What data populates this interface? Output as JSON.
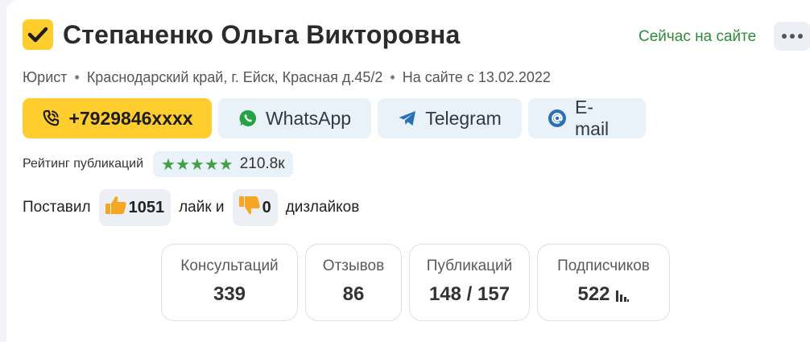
{
  "profile": {
    "name": "Степаненко Ольга Викторовна",
    "online_status": "Сейчас на сайте",
    "role": "Юрист",
    "location": "Краснодарский край, г. Ейск, Красная д.45/2",
    "member_since": "На сайте с 13.02.2022",
    "separator": "•"
  },
  "contacts": {
    "phone": "+7929846xxxx",
    "whatsapp": "WhatsApp",
    "telegram": "Telegram",
    "email": "E-mail"
  },
  "rating": {
    "label": "Рейтинг публикаций",
    "stars": "★★★★★",
    "value": "210.8к"
  },
  "reactions": {
    "prefix": "Поставил",
    "likes": "1051",
    "middle": "лайк и",
    "dislikes": "0",
    "suffix": "дизлайков"
  },
  "stats": [
    {
      "label": "Консультаций",
      "value": "339"
    },
    {
      "label": "Отзывов",
      "value": "86"
    },
    {
      "label": "Публикаций",
      "value": "148 / 157"
    },
    {
      "label": "Подписчиков",
      "value": "522"
    }
  ],
  "colors": {
    "accent_yellow": "#ffcd2e",
    "online_green": "#2e8b3a",
    "star_green": "#43a047",
    "soft_button": "#e9f1f9",
    "like_orange": "#f5a623"
  }
}
